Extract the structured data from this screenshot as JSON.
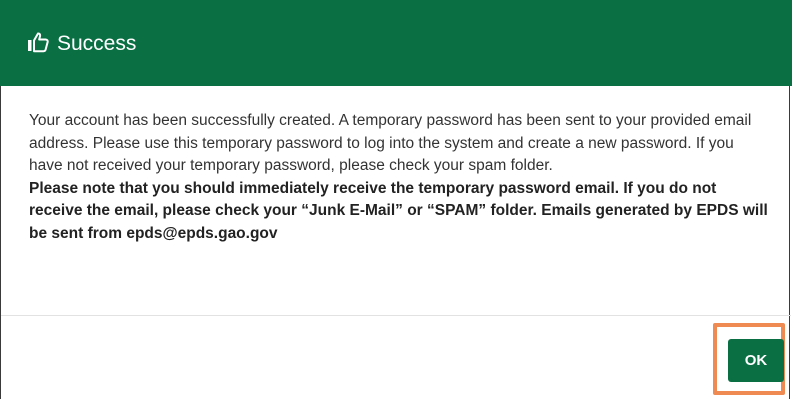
{
  "dialog": {
    "header": {
      "icon": "thumbs-up-icon",
      "title": "Success",
      "background": "#0a7044"
    },
    "body": {
      "paragraph": "Your account has been successfully created. A temporary password has been sent to your provided email address. Please use this temporary password to log into the system and create a new password. If you have not received your temporary password, please check your spam folder.",
      "notice": "Please note that you should immediately receive the temporary password email. If you do not receive the email, please check your “Junk E-Mail” or “SPAM” folder. Emails generated by EPDS will be sent from epds@epds.gao.gov"
    },
    "footer": {
      "ok_label": "OK",
      "highlight_color": "#ef8a52"
    }
  }
}
